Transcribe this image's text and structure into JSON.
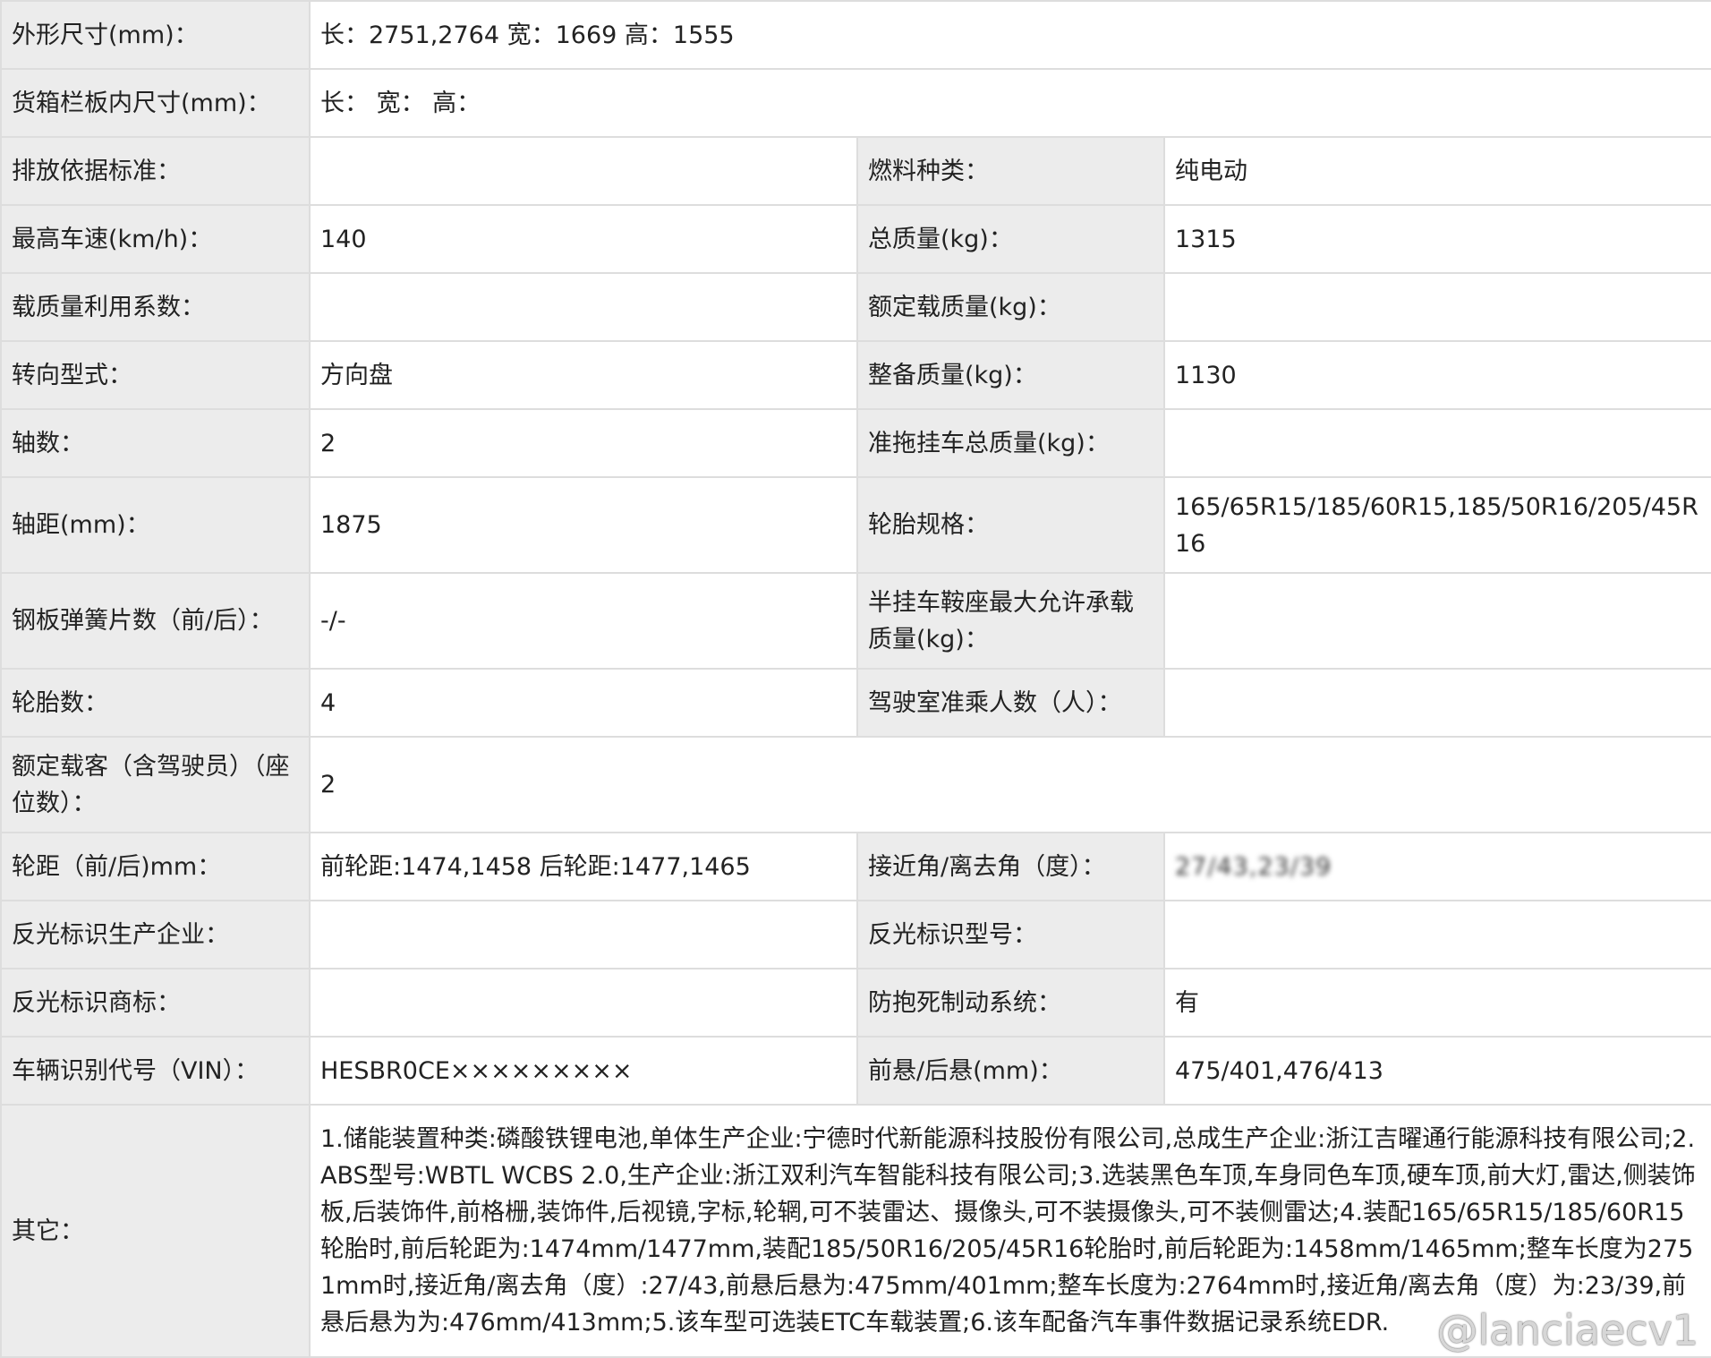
{
  "rows": {
    "dimensions": {
      "label": "外形尺寸(mm)：",
      "value": "长：2751,2764 宽：1669 高：1555"
    },
    "cargo_box": {
      "label": "货箱栏板内尺寸(mm)：",
      "value": "长： 宽： 高："
    },
    "emission": {
      "label": "排放依据标准：",
      "value": "",
      "label2": "燃料种类：",
      "value2": "纯电动"
    },
    "speed": {
      "label": "最高车速(km/h)：",
      "value": "140",
      "label2": "总质量(kg)：",
      "value2": "1315"
    },
    "load_factor": {
      "label": "载质量利用系数：",
      "value": "",
      "label2": "额定载质量(kg)：",
      "value2": ""
    },
    "steering": {
      "label": "转向型式：",
      "value": "方向盘",
      "label2": "整备质量(kg)：",
      "value2": "1130"
    },
    "axles": {
      "label": "轴数：",
      "value": "2",
      "label2": "准拖挂车总质量(kg)：",
      "value2": ""
    },
    "wheelbase": {
      "label": "轴距(mm)：",
      "value": "1875",
      "label2": "轮胎规格：",
      "value2": "165/65R15/185/60R15,185/50R16/205/45R16"
    },
    "springs": {
      "label": "钢板弹簧片数（前/后）：",
      "value": "-/-",
      "label2": "半挂车鞍座最大允许承载质量(kg)：",
      "value2": ""
    },
    "tires": {
      "label": "轮胎数：",
      "value": "4",
      "label2": "驾驶室准乘人数（人）：",
      "value2": ""
    },
    "passengers": {
      "label": "额定载客（含驾驶员）（座位数）：",
      "value": "2"
    },
    "track": {
      "label": "轮距（前/后)mm：",
      "value": "前轮距:1474,1458 后轮距:1477,1465",
      "label2": "接近角/离去角（度）：",
      "value2": "27/43,23/39"
    },
    "reflector_maker": {
      "label": "反光标识生产企业：",
      "value": "",
      "label2": "反光标识型号：",
      "value2": ""
    },
    "reflector_brand": {
      "label": "反光标识商标：",
      "value": "",
      "label2": "防抱死制动系统：",
      "value2": "有"
    },
    "vin": {
      "label": "车辆识别代号（VIN）：",
      "value": "HESBR0CE×××××××××",
      "label2": "前悬/后悬(mm)：",
      "value2": "475/401,476/413"
    },
    "other": {
      "label": "其它：",
      "value": "1.储能装置种类:磷酸铁锂电池,单体生产企业:宁德时代新能源科技股份有限公司,总成生产企业:浙江吉曜通行能源科技有限公司;2.ABS型号:WBTL WCBS 2.0,生产企业:浙江双利汽车智能科技有限公司;3.选装黑色车顶,车身同色车顶,硬车顶,前大灯,雷达,侧装饰板,后装饰件,前格栅,装饰件,后视镜,字标,轮辋,可不装雷达、摄像头,可不装摄像头,可不装侧雷达;4.装配165/65R15/185/60R15轮胎时,前后轮距为:1474mm/1477mm,装配185/50R16/205/45R16轮胎时,前后轮距为:1458mm/1465mm;整车长度为2751mm时,接近角/离去角（度）:27/43,前悬后悬为:475mm/401mm;整车长度为:2764mm时,接近角/离去角（度）为:23/39,前悬后悬为为:476mm/413mm;5.该车型可选装ETC车载装置;6.该车配备汽车事件数据记录系统EDR."
    }
  },
  "watermark": "@lanciaecv1"
}
